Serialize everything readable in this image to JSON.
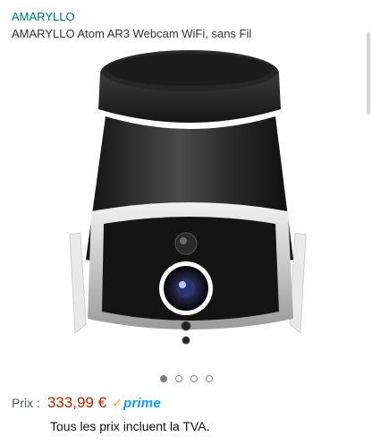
{
  "product": {
    "brand": "AMARYLLO",
    "title": "AMARYLLO Atom AR3 Webcam WiFi, sans Fil"
  },
  "gallery": {
    "image_icon": "security-camera-product-photo",
    "page_count": 4,
    "active_index": 0
  },
  "pricing": {
    "label": "Prix :",
    "price": "333,99 €",
    "prime_label": "prime",
    "tax_note": "Tous les prix incluent la TVA."
  },
  "colors": {
    "brand_link": "#007185",
    "price": "#b12704",
    "prime_blue": "#1399ff",
    "prime_check": "#f2a33a"
  }
}
